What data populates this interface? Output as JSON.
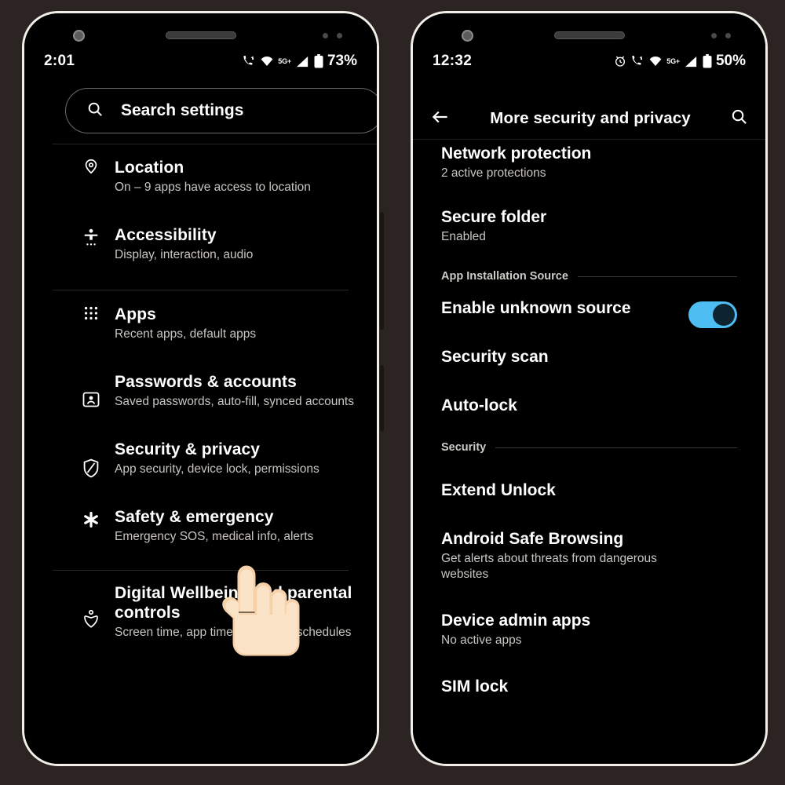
{
  "background_color": "#2b2422",
  "accent_color": "#4dbdf2",
  "phones": {
    "left": {
      "status_bar": {
        "time": "2:01",
        "network_label": "5G+",
        "battery_text": "73%",
        "icons": [
          "phone-signal-icon",
          "wifi-icon",
          "network-5g-label",
          "cell-signal-icon",
          "battery-icon"
        ]
      },
      "search": {
        "placeholder": "Search settings",
        "icon": "search-icon"
      },
      "items": [
        {
          "icon": "location-pin-icon",
          "title": "Location",
          "subtitle": "On – 9 apps have access to location"
        },
        {
          "icon": "accessibility-person-icon",
          "title": "Accessibility",
          "subtitle": "Display, interaction, audio"
        },
        {
          "icon": "apps-grid-icon",
          "title": "Apps",
          "subtitle": "Recent apps, default apps"
        },
        {
          "icon": "password-badge-icon",
          "title": "Passwords & accounts",
          "subtitle": "Saved passwords, auto-fill, synced accounts"
        },
        {
          "icon": "shield-icon",
          "title": "Security & privacy",
          "subtitle": "App security, device lock, permissions"
        },
        {
          "icon": "asterisk-emergency-icon",
          "title": "Safety & emergency",
          "subtitle": "Emergency SOS, medical info, alerts"
        },
        {
          "icon": "wellbeing-heart-icon",
          "title": "Digital Wellbeing and parental controls",
          "subtitle": "Screen time, app timers, bedtime schedules"
        }
      ],
      "cursor": "pointing-hand-cursor"
    },
    "right": {
      "status_bar": {
        "time": "12:32",
        "network_label": "5G+",
        "battery_text": "50%",
        "icons": [
          "alarm-icon",
          "phone-signal-icon",
          "wifi-icon",
          "network-5g-label",
          "cell-signal-icon",
          "battery-icon"
        ]
      },
      "appbar": {
        "back_icon": "back-arrow-icon",
        "title": "More security and privacy",
        "search_icon": "search-icon"
      },
      "items": [
        {
          "type": "item",
          "title": "Network protection",
          "subtitle": "2 active protections"
        },
        {
          "type": "item",
          "title": "Secure folder",
          "subtitle": "Enabled"
        },
        {
          "type": "section",
          "title": "App Installation Source"
        },
        {
          "type": "toggle",
          "title": "Enable unknown source",
          "subtitle": "",
          "toggle_state": "on"
        },
        {
          "type": "item",
          "title": "Security scan",
          "subtitle": ""
        },
        {
          "type": "item",
          "title": "Auto-lock",
          "subtitle": ""
        },
        {
          "type": "section",
          "title": "Security"
        },
        {
          "type": "item",
          "title": "Extend Unlock",
          "subtitle": ""
        },
        {
          "type": "item",
          "title": "Android Safe Browsing",
          "subtitle": "Get alerts about threats from dangerous websites"
        },
        {
          "type": "item",
          "title": "Device admin apps",
          "subtitle": "No active apps"
        },
        {
          "type": "item",
          "title": "SIM lock",
          "subtitle": ""
        }
      ],
      "cursor": "pointing-hand-cursor"
    }
  }
}
